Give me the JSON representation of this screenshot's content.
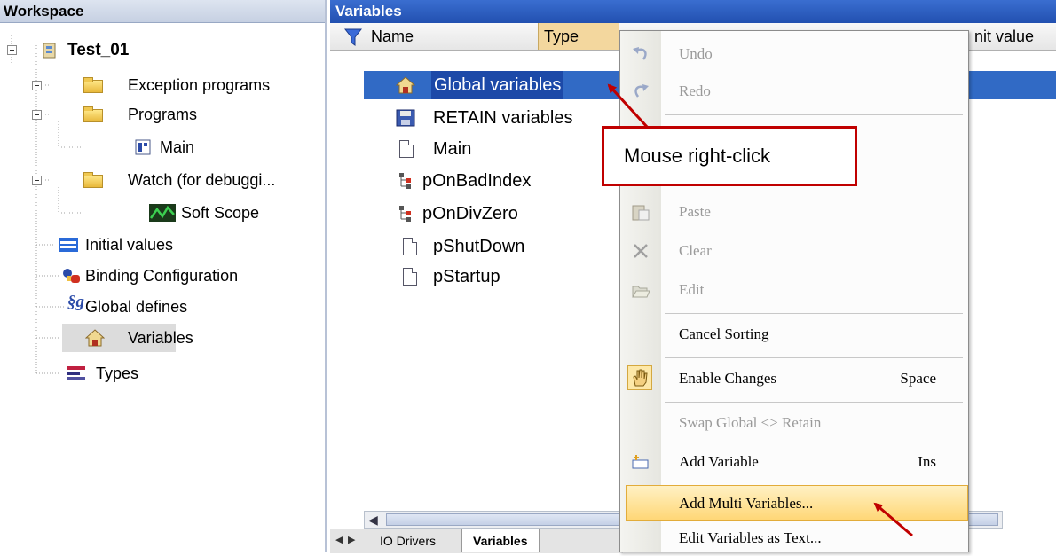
{
  "workspace": {
    "title": "Workspace",
    "tree": [
      {
        "label": "Test_01",
        "icon": "project-icon"
      },
      {
        "label": "Exception programs",
        "icon": "folder-icon"
      },
      {
        "label": "Programs",
        "icon": "folder-icon"
      },
      {
        "label": "Main",
        "icon": "program-icon"
      },
      {
        "label": "Watch (for debuggi...",
        "icon": "folder-icon"
      },
      {
        "label": "Soft Scope",
        "icon": "scope-icon"
      },
      {
        "label": "Initial values",
        "icon": "initial-values-icon"
      },
      {
        "label": "Binding Configuration",
        "icon": "binding-icon"
      },
      {
        "label": "Global defines",
        "icon": "defines-icon"
      },
      {
        "label": "Variables",
        "icon": "variables-icon"
      },
      {
        "label": "Types",
        "icon": "types-icon"
      }
    ]
  },
  "variables": {
    "title": "Variables",
    "columns": {
      "name": "Name",
      "type": "Type",
      "init": "nit value"
    },
    "rows": [
      {
        "label": "Global variables",
        "icon": "home-icon"
      },
      {
        "label": "RETAIN variables",
        "icon": "save-icon"
      },
      {
        "label": "Main",
        "icon": "document-icon"
      },
      {
        "label": "pOnBadIndex",
        "icon": "structure-icon"
      },
      {
        "label": "pOnDivZero",
        "icon": "structure-icon"
      },
      {
        "label": "pShutDown",
        "icon": "document-icon"
      },
      {
        "label": "pStartup",
        "icon": "document-icon"
      }
    ],
    "tabs": [
      "IO Drivers",
      "Variables"
    ]
  },
  "context_menu": {
    "items": [
      {
        "label": "Undo",
        "shortcut": "",
        "enabled": false
      },
      {
        "label": "Redo",
        "shortcut": "",
        "enabled": false
      },
      {
        "label": "Paste",
        "shortcut": "",
        "enabled": false
      },
      {
        "label": "Clear",
        "shortcut": "",
        "enabled": false
      },
      {
        "label": "Edit",
        "shortcut": "",
        "enabled": false
      },
      {
        "label": "Cancel Sorting",
        "shortcut": "",
        "enabled": true
      },
      {
        "label": "Enable Changes",
        "shortcut": "Space",
        "enabled": true
      },
      {
        "label": "Swap Global <> Retain",
        "shortcut": "",
        "enabled": false
      },
      {
        "label": "Add Variable",
        "shortcut": "Ins",
        "enabled": true
      },
      {
        "label": "Add Multi Variables...",
        "shortcut": "",
        "enabled": true
      },
      {
        "label": "Edit Variables as Text...",
        "shortcut": "",
        "enabled": true
      }
    ]
  },
  "annotation": {
    "text": "Mouse right-click",
    "color": "#c00000"
  },
  "colors": {
    "selection": "#316ac5",
    "menu_highlight": "#ffd777",
    "header_blue": "#2a5bc0"
  }
}
